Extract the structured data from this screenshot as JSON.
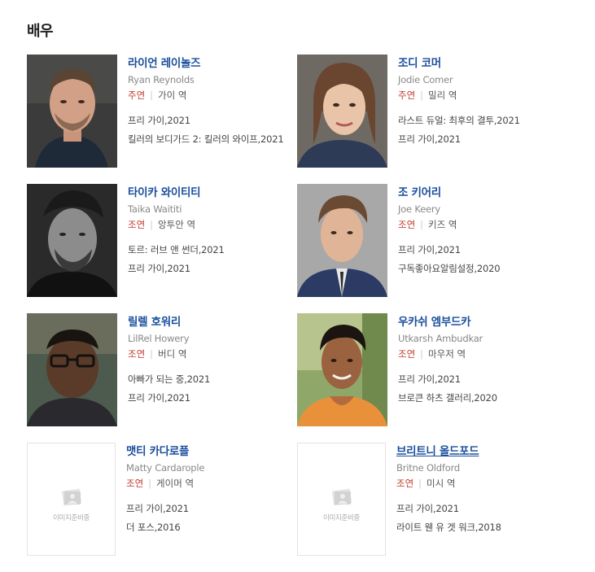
{
  "section": {
    "title": "배우"
  },
  "actors": [
    {
      "name_ko": "라이언 레이놀즈",
      "name_en": "Ryan Reynolds",
      "role_type": "주연",
      "role": "가이 역",
      "works": [
        "프리 가이,2021",
        "킬러의 보디가드 2: 킬러의 와이프,2021"
      ],
      "photo": "ryan"
    },
    {
      "name_ko": "조디 코머",
      "name_en": "Jodie Comer",
      "role_type": "주연",
      "role": "밀리 역",
      "works": [
        "라스트 듀얼: 최후의 결투,2021",
        "프리 가이,2021"
      ],
      "photo": "jodie"
    },
    {
      "name_ko": "타이카 와이티티",
      "name_en": "Taika Waititi",
      "role_type": "조연",
      "role": "앙투안 역",
      "works": [
        "토르: 러브 앤 썬더,2021",
        "프리 가이,2021"
      ],
      "photo": "taika"
    },
    {
      "name_ko": "조 키어리",
      "name_en": "Joe Keery",
      "role_type": "조연",
      "role": "키즈 역",
      "works": [
        "프리 가이,2021",
        "구독좋아요알림설정,2020"
      ],
      "photo": "joe"
    },
    {
      "name_ko": "릴렐 호워리",
      "name_en": "LilRel Howery",
      "role_type": "조연",
      "role": "버디 역",
      "works": [
        "아빠가 되는 중,2021",
        "프리 가이,2021"
      ],
      "photo": "lilrel"
    },
    {
      "name_ko": "우카쉬 엠부드카",
      "name_en": "Utkarsh Ambudkar",
      "role_type": "조연",
      "role": "마우저 역",
      "works": [
        "프리 가이,2021",
        "브로큰 하츠 갤러리,2020"
      ],
      "photo": "utkarsh"
    },
    {
      "name_ko": "맷티 카다로플",
      "name_en": "Matty Cardarople",
      "role_type": "조연",
      "role": "게이머 역",
      "works": [
        "프리 가이,2021",
        "더 포스,2016"
      ],
      "photo": "placeholder"
    },
    {
      "name_ko": "브리트니 올드포드",
      "name_en": "Britne Oldford",
      "role_type": "조연",
      "role": "미시 역",
      "works": [
        "프리 가이,2021",
        "라이트 웬 유 겟 워크,2018"
      ],
      "photo": "placeholder"
    }
  ],
  "placeholder_text": "이미지준비중",
  "colors": {
    "name_link": "#1b4f9c",
    "role_type": "#c0392b",
    "english_name": "#888888"
  }
}
